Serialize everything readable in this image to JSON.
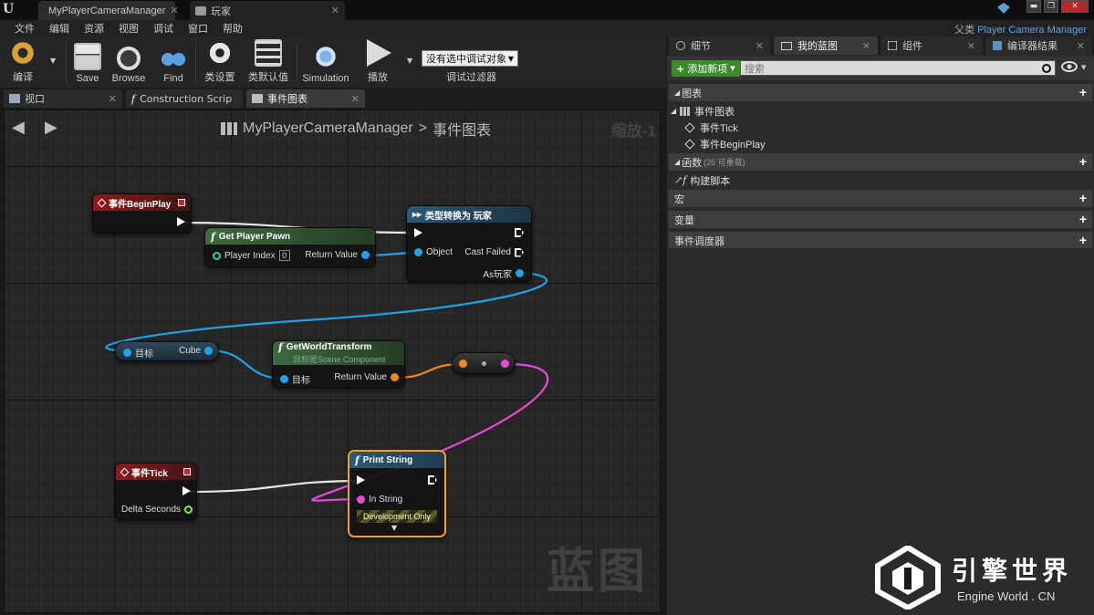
{
  "window": {
    "tabs": [
      {
        "label": "MyPlayerCameraManager"
      },
      {
        "label": "玩家"
      }
    ],
    "min_symbol": "▬",
    "max_symbol": "❐",
    "close_symbol": "✕"
  },
  "menu": [
    "文件",
    "编辑",
    "资源",
    "视图",
    "调试",
    "窗口",
    "帮助"
  ],
  "parent_class": {
    "label": "父类",
    "value": "Player Camera Manager"
  },
  "toolbar": {
    "buttons": [
      {
        "label": "编译",
        "icon": "compile-gear-icon"
      },
      {
        "label": "Save",
        "icon": "save-disk-icon"
      },
      {
        "label": "Browse",
        "icon": "browse-magnifier-icon"
      },
      {
        "label": "Find",
        "icon": "find-binoculars-icon"
      },
      {
        "label": "类设置",
        "icon": "class-settings-gear-icon"
      },
      {
        "label": "类默认值",
        "icon": "class-defaults-checklist-icon"
      },
      {
        "label": "Simulation",
        "icon": "simulation-icon"
      },
      {
        "label": "播放",
        "icon": "play-icon"
      }
    ],
    "debug_selector": "没有选中调试对象",
    "debug_filter_label": "调试过滤器"
  },
  "panel_tabs": [
    {
      "label": "视口",
      "icon": "viewport-icon"
    },
    {
      "label": "Construction Scrip",
      "icon": "function-icon"
    },
    {
      "label": "事件图表",
      "icon": "event-graph-icon"
    }
  ],
  "graph": {
    "breadcrumb": {
      "asset": "MyPlayerCameraManager",
      "separator": ">",
      "graph": "事件图表"
    },
    "zoom": "缩放-1",
    "watermark": "蓝图",
    "nodes": {
      "begin_play": {
        "title": "事件BeginPlay"
      },
      "get_player_pawn": {
        "title": "Get Player Pawn",
        "player_index_label": "Player Index",
        "player_index_value": "0",
        "return_label": "Return Value"
      },
      "cast": {
        "title": "类型转换为 玩家",
        "object_label": "Object",
        "cast_failed_label": "Cast Failed",
        "as_label": "As玩家"
      },
      "cube_getter": {
        "target_label": "目标",
        "cube_label": "Cube"
      },
      "get_world_transform": {
        "title": "GetWorldTransform",
        "subtitle": "目标是Scene Component",
        "target_label": "目标",
        "return_label": "Return Value"
      },
      "tick": {
        "title": "事件Tick",
        "delta_label": "Delta Seconds"
      },
      "print_string": {
        "title": "Print String",
        "in_string_label": "In String",
        "dev_only": "Development Only",
        "expand": "▼"
      }
    }
  },
  "right_panel": {
    "tabs": [
      {
        "label": "细节",
        "icon": "details-icon"
      },
      {
        "label": "我的蓝图",
        "icon": "my-blueprint-icon"
      },
      {
        "label": "组件",
        "icon": "components-icon"
      },
      {
        "label": "编译器结果",
        "icon": "compiler-results-icon"
      }
    ],
    "add_new": "添加新项",
    "search_placeholder": "搜索",
    "sections": {
      "graphs": {
        "label": "图表",
        "children": [
          {
            "label": "事件图表",
            "children": [
              "事件Tick",
              "事件BeginPlay"
            ]
          }
        ]
      },
      "functions": {
        "label": "函数",
        "note": "(25 可重载)",
        "children": [
          "构建脚本"
        ]
      },
      "macros": {
        "label": "宏"
      },
      "variables": {
        "label": "变量"
      },
      "dispatchers": {
        "label": "事件调度器"
      }
    }
  },
  "branding": {
    "name": "引擎世界",
    "sub": "Engine World . CN"
  }
}
